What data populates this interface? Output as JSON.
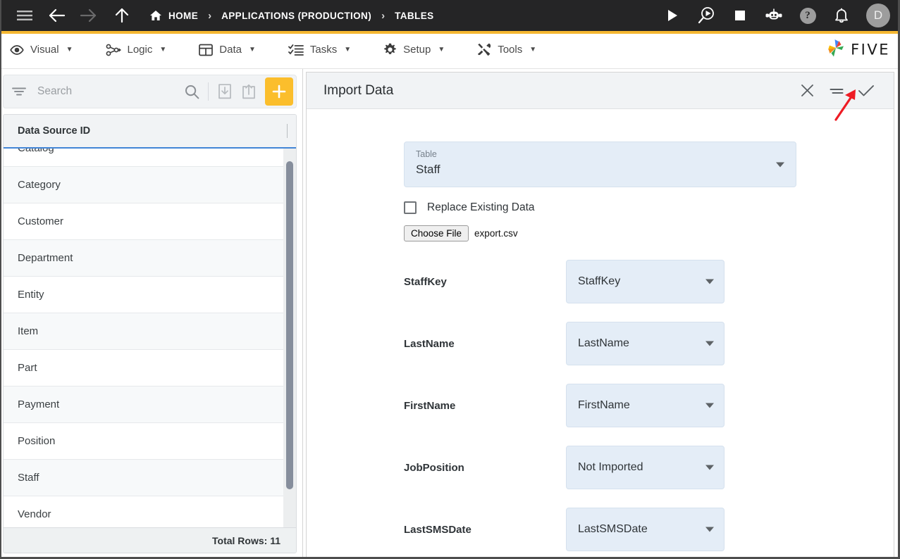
{
  "topbar": {
    "nav_icons": [
      {
        "name": "menu-icon",
        "label": "Menu"
      },
      {
        "name": "back-arrow-icon",
        "label": "Back"
      },
      {
        "name": "forward-arrow-icon",
        "label": "Forward"
      },
      {
        "name": "up-arrow-icon",
        "label": "Up"
      }
    ],
    "breadcrumbs": [
      {
        "label": "HOME",
        "icon": "home-icon"
      },
      {
        "label": "APPLICATIONS (PRODUCTION)",
        "icon": ""
      },
      {
        "label": "TABLES",
        "icon": ""
      }
    ],
    "separator": "›",
    "actions": [
      {
        "name": "run-icon",
        "label": "Run"
      },
      {
        "name": "debug-icon",
        "label": "Debug"
      },
      {
        "name": "stop-icon",
        "label": "Stop"
      },
      {
        "name": "robot-icon",
        "label": "AI Assistant"
      },
      {
        "name": "help-icon",
        "label": "?"
      },
      {
        "name": "notifications-bell-icon",
        "label": "Notifications"
      }
    ],
    "avatar_initial": "D",
    "accent_color": "#f5b731",
    "background_color": "#252526"
  },
  "menubar": {
    "items": [
      {
        "label": "Visual",
        "icon": "eye-icon"
      },
      {
        "label": "Logic",
        "icon": "flow-icon"
      },
      {
        "label": "Data",
        "icon": "table-icon"
      },
      {
        "label": "Tasks",
        "icon": "checklist-icon"
      },
      {
        "label": "Setup",
        "icon": "gear-icon"
      },
      {
        "label": "Tools",
        "icon": "tools-icon"
      }
    ],
    "caret": "▼",
    "logo_text": "FIVE"
  },
  "sidebar": {
    "search": {
      "placeholder": "Search",
      "value": "",
      "filter_icon": "filter-icon",
      "search_icon": "search-icon",
      "import_icon": "import-icon",
      "export_icon": "export-icon",
      "add_label": "+",
      "add_color": "#fbbe2c"
    },
    "grid": {
      "column_header": "Data Source ID",
      "rows": [
        "Catalog",
        "Category",
        "Customer",
        "Department",
        "Entity",
        "Item",
        "Part",
        "Payment",
        "Position",
        "Staff",
        "Vendor"
      ],
      "footer": "Total Rows: 11"
    }
  },
  "panel": {
    "title": "Import Data",
    "header_actions": [
      {
        "name": "close-icon",
        "label": "Close"
      },
      {
        "name": "list-menu-icon",
        "label": "Menu"
      },
      {
        "name": "confirm-check-icon",
        "label": "Confirm"
      }
    ],
    "table_select": {
      "label": "Table",
      "value": "Staff"
    },
    "replace_checkbox": {
      "label": "Replace Existing Data",
      "checked": false
    },
    "file_input": {
      "button_label": "Choose File",
      "file_name": "export.csv"
    },
    "mappings": [
      {
        "field": "StaffKey",
        "value": "StaffKey"
      },
      {
        "field": "LastName",
        "value": "LastName"
      },
      {
        "field": "FirstName",
        "value": "FirstName"
      },
      {
        "field": "JobPosition",
        "value": "Not Imported"
      },
      {
        "field": "LastSMSDate",
        "value": "LastSMSDate"
      }
    ],
    "annotation": {
      "type": "red-arrow",
      "points_to": "confirm-check-icon",
      "color": "#ee1b24"
    }
  }
}
